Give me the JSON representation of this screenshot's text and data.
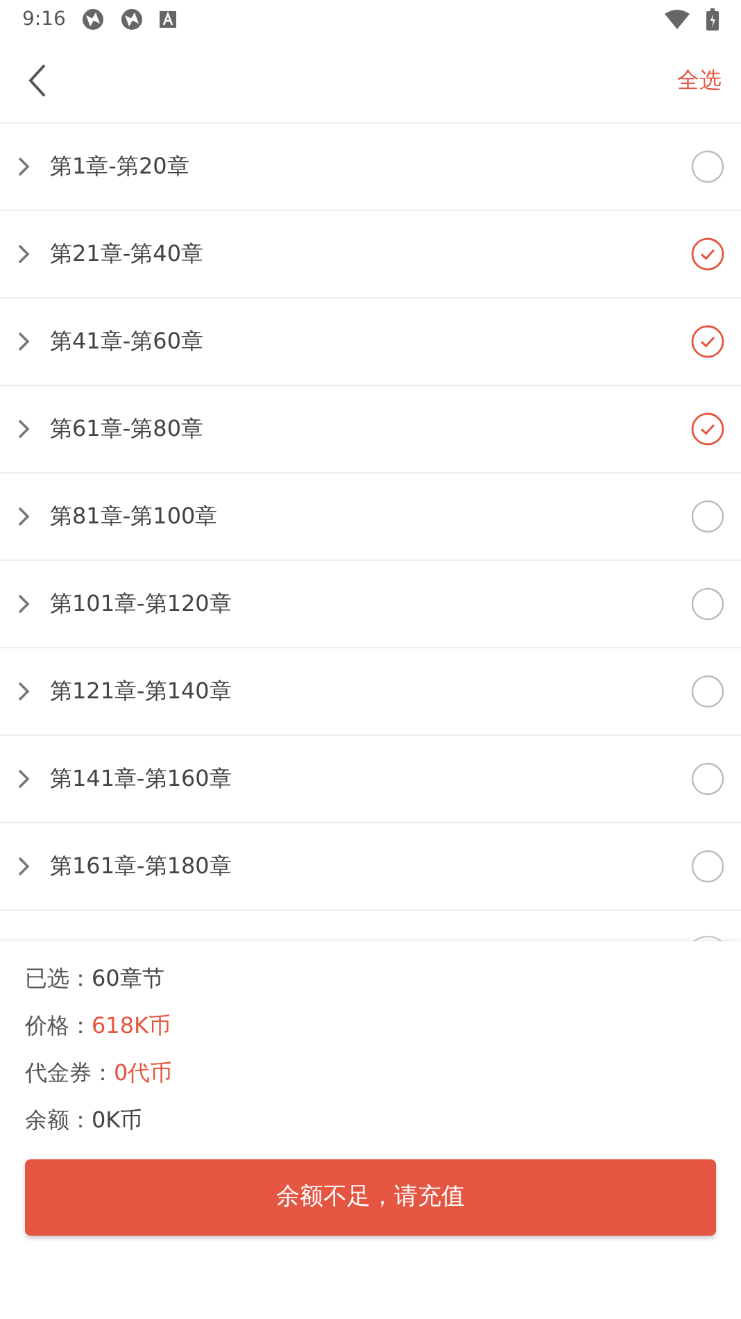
{
  "status_bar": {
    "time": "9:16"
  },
  "header": {
    "select_all": "全选"
  },
  "chapters": [
    {
      "label": "第1章-第20章",
      "checked": false
    },
    {
      "label": "第21章-第40章",
      "checked": true
    },
    {
      "label": "第41章-第60章",
      "checked": true
    },
    {
      "label": "第61章-第80章",
      "checked": true
    },
    {
      "label": "第81章-第100章",
      "checked": false
    },
    {
      "label": "第101章-第120章",
      "checked": false
    },
    {
      "label": "第121章-第140章",
      "checked": false
    },
    {
      "label": "第141章-第160章",
      "checked": false
    },
    {
      "label": "第161章-第180章",
      "checked": false
    }
  ],
  "summary": [
    {
      "label": "已选：",
      "value": "60章节",
      "highlight": false
    },
    {
      "label": "价格：",
      "value": "618K币",
      "highlight": true
    },
    {
      "label": "代金券：",
      "value": "0代币",
      "highlight": true
    },
    {
      "label": "余额：",
      "value": "0K币",
      "highlight": false
    }
  ],
  "action_button": "余额不足，请充值"
}
